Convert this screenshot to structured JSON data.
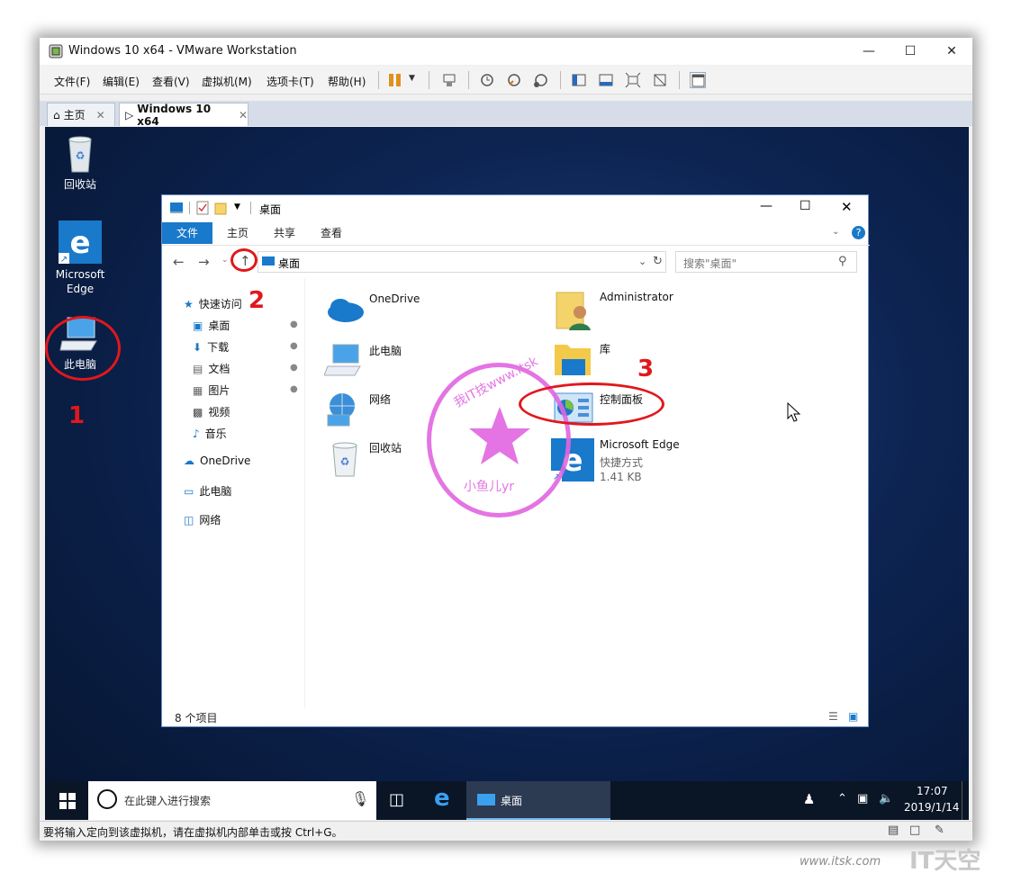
{
  "window": {
    "title": "Windows 10 x64 - VMware Workstation"
  },
  "menubar": {
    "items": [
      "文件(F)",
      "编辑(E)",
      "查看(V)",
      "虚拟机(M)",
      "选项卡(T)",
      "帮助(H)"
    ]
  },
  "tabs": [
    {
      "label": "主页"
    },
    {
      "label": "Windows 10 x64"
    }
  ],
  "desktop": {
    "icons": [
      {
        "label": "回收站"
      },
      {
        "label": "Microsoft Edge"
      },
      {
        "label": "此电脑"
      }
    ]
  },
  "explorer": {
    "title": "桌面",
    "ribbon_tabs": [
      "文件",
      "主页",
      "共享",
      "查看"
    ],
    "address": "桌面",
    "search_placeholder": "搜索\"桌面\"",
    "nav": {
      "quick_access": "快速访问",
      "items": [
        "桌面",
        "下载",
        "文档",
        "图片",
        "视频",
        "音乐"
      ],
      "onedrive": "OneDrive",
      "this_pc": "此电脑",
      "network": "网络"
    },
    "files": {
      "onedrive": "OneDrive",
      "this_pc": "此电脑",
      "network": "网络",
      "recycle": "回收站",
      "admin": "Administrator",
      "library": "库",
      "control_panel": "控制面板",
      "edge": "Microsoft Edge",
      "edge_type": "快捷方式",
      "edge_size": "1.41 KB"
    },
    "status": "8 个项目"
  },
  "taskbar": {
    "search_placeholder": "在此键入进行搜索",
    "active_app": "桌面",
    "time": "17:07",
    "date": "2019/1/14"
  },
  "statusbar": {
    "text": "要将输入定向到该虚拟机，请在虚拟机内部单击或按 Ctrl+G。"
  },
  "annotations": {
    "n1": "1",
    "n2": "2",
    "n3": "3"
  },
  "stamp": {
    "text": "我IT技www.itsk",
    "sub": "小鱼儿yr"
  },
  "watermark": {
    "site": "www.itsk.com",
    "brand": "IT天空"
  },
  "colors": {
    "accent": "#1979ca",
    "annotation": "#e0181c",
    "stamp": "#e266e0"
  }
}
